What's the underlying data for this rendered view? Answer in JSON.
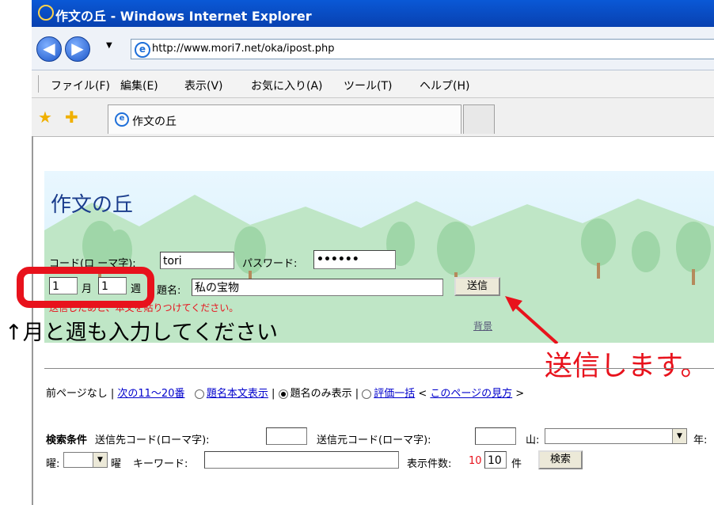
{
  "window": {
    "title": "作文の丘 - Windows Internet Explorer"
  },
  "address": {
    "url": "http://www.mori7.net/oka/ipost.php"
  },
  "menu": [
    "ファイル(F)",
    "編集(E)",
    "表示(V)",
    "お気に入り(A)",
    "ツール(T)",
    "ヘルプ(H)"
  ],
  "tab": {
    "label": "作文の丘"
  },
  "site": {
    "title": "作文の丘"
  },
  "form": {
    "code_label": "コード(ロ ーマ字):",
    "code_value": "tori",
    "password_label": "パスワード:",
    "password_value": "••••••",
    "month_value": "1",
    "month_label": "月",
    "week_value": "1",
    "week_label": "週",
    "title_label": "題名:",
    "title_value": "私の宝物",
    "send_button": "送信",
    "hint": "送信したあと、本文を貼りつけてください。",
    "background_link": "背景"
  },
  "annotations": {
    "month_week_note": "↑月と週も入力してください",
    "send_note": "送信します。"
  },
  "nav": {
    "prev": "前ページなし | ",
    "next": "次の11～20番",
    "opt1": "題名本文表示",
    "sep1": " | ",
    "opt2": "題名のみ表示",
    "sep2": " | ",
    "opt3": "評価一括",
    "guide_open": " < ",
    "guide": "このページの見方",
    "guide_close": " >"
  },
  "search": {
    "label": "検索条件",
    "to_code": "送信先コード(ローマ字):",
    "from_code": "送信元コード(ローマ字):",
    "mountain": "山:",
    "year": "年:",
    "weekday": "曜:",
    "weekday_suffix": "曜",
    "keyword": "キーワード:",
    "count_label": "表示件数:",
    "count_current": "10",
    "count_value": "10",
    "count_unit": "件",
    "search_button": "検索"
  },
  "colors": {
    "annotation": "#e8121c",
    "title": "#1a3c8c",
    "link": "#0000cc"
  }
}
